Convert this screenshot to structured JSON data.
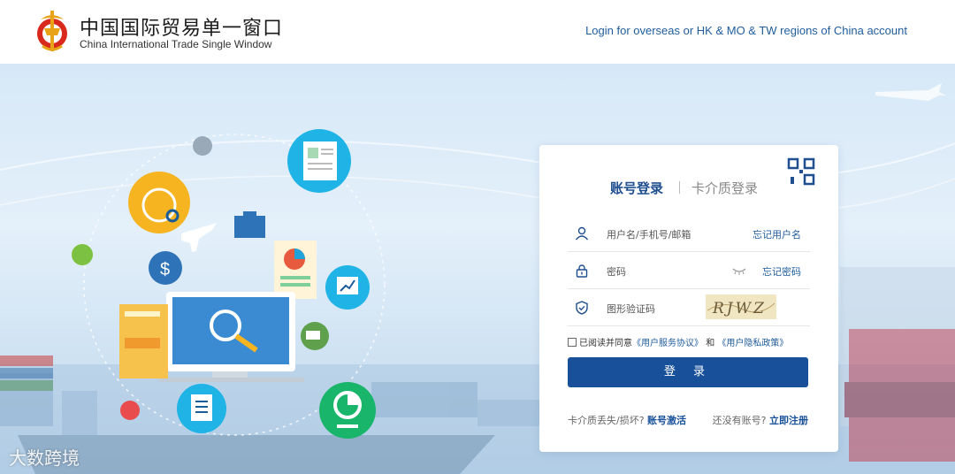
{
  "header": {
    "brand_cn": "中国国际贸易单一窗口",
    "brand_en": "China International Trade Single Window",
    "overseas_link": "Login for overseas or HK & MO & TW regions of China account"
  },
  "login": {
    "tab_account": "账号登录",
    "tab_card": "卡介质登录",
    "username_placeholder": "用户名/手机号/邮箱",
    "forgot_username": "忘记用户名",
    "password_placeholder": "密码",
    "forgot_password": "忘记密码",
    "captcha_placeholder": "图形验证码",
    "captcha_text": "RJWZ",
    "agree_prefix": "已阅读并同意",
    "service_agreement": "《用户服务协议》",
    "agree_and": "和",
    "privacy_policy": "《用户隐私政策》",
    "login_button": "登 录",
    "card_lost_text": "卡介质丢失/损坏?",
    "activate_link": "账号激活",
    "no_account_text": "还没有账号?",
    "register_link": "立即注册"
  },
  "watermark": "大数跨境",
  "colors": {
    "primary": "#18519a",
    "link": "#1f5c9c"
  }
}
